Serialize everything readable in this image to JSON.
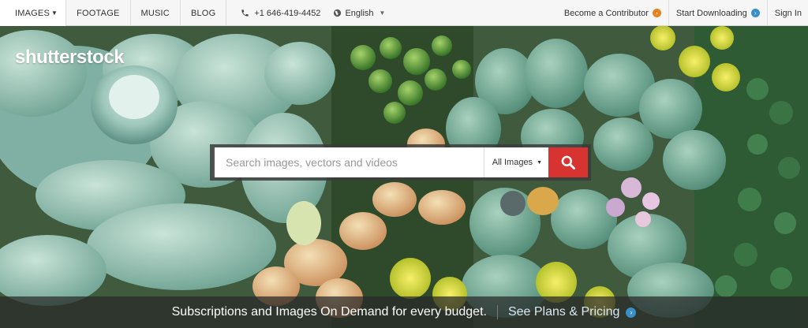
{
  "nav": {
    "tabs": [
      {
        "label": "IMAGES"
      },
      {
        "label": "FOOTAGE"
      },
      {
        "label": "MUSIC"
      },
      {
        "label": "BLOG"
      }
    ],
    "phone": "+1 646-419-4452",
    "language": "English",
    "right_links": [
      {
        "label": "Become a Contributor",
        "icon": "orange-arrow-circle-icon"
      },
      {
        "label": "Start Downloading",
        "icon": "blue-arrow-circle-icon"
      },
      {
        "label": "Sign In"
      }
    ]
  },
  "hero": {
    "logo": "shutterstock",
    "search": {
      "placeholder": "Search images, vectors and videos",
      "filter_label": "All Images"
    },
    "promo": {
      "text": "Subscriptions and Images On Demand for every budget.",
      "link": "See Plans & Pricing"
    }
  },
  "colors": {
    "accent_red": "#d73330",
    "accent_orange": "#e8821e",
    "accent_blue": "#3a8fc9"
  }
}
